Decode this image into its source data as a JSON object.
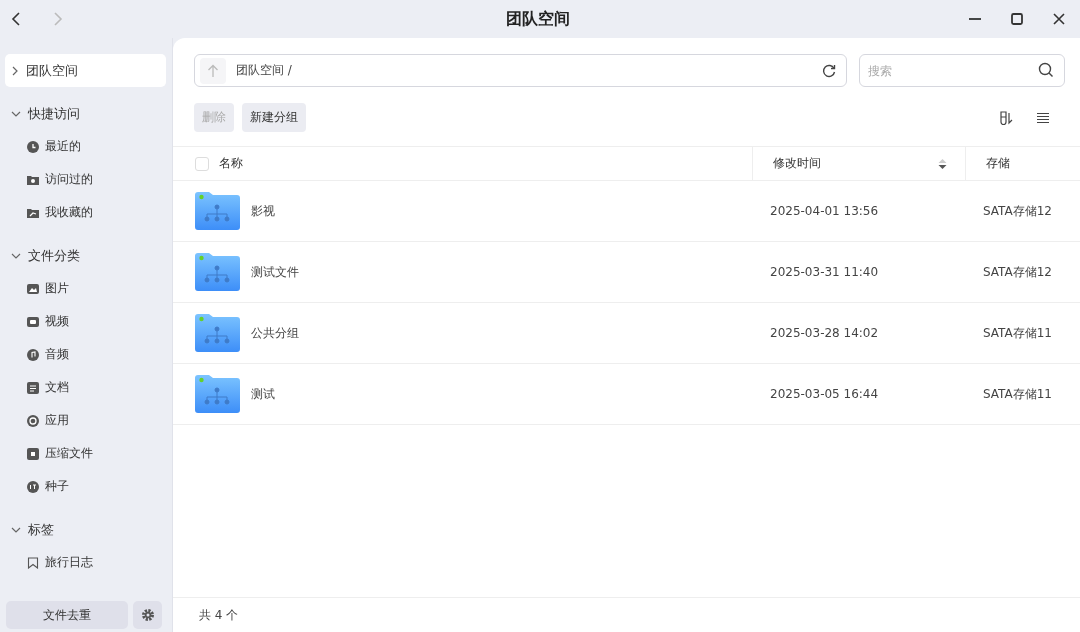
{
  "window": {
    "title": "团队空间"
  },
  "sidebar": {
    "top_item": {
      "label": "团队空间",
      "selected": true,
      "expanded": false
    },
    "groups": [
      {
        "label": "快捷访问",
        "expanded": true,
        "items": [
          {
            "label": "最近的",
            "kind": "clock"
          },
          {
            "label": "访问过的",
            "kind": "visited"
          },
          {
            "label": "我收藏的",
            "kind": "starred"
          }
        ]
      },
      {
        "label": "文件分类",
        "expanded": true,
        "items": [
          {
            "label": "图片",
            "kind": "image"
          },
          {
            "label": "视频",
            "kind": "video"
          },
          {
            "label": "音频",
            "kind": "audio"
          },
          {
            "label": "文档",
            "kind": "document"
          },
          {
            "label": "应用",
            "kind": "app"
          },
          {
            "label": "压缩文件",
            "kind": "archive"
          },
          {
            "label": "种子",
            "kind": "torrent"
          }
        ]
      },
      {
        "label": "标签",
        "expanded": true,
        "items": [
          {
            "label": "旅行日志",
            "kind": "tag"
          }
        ]
      }
    ],
    "bottom_button": "文件去重"
  },
  "path_bar": {
    "path": "团队空间 /"
  },
  "search": {
    "placeholder": "搜索"
  },
  "toolbar": {
    "buttons": [
      {
        "label": "删除",
        "disabled": true
      },
      {
        "label": "新建分组",
        "disabled": false
      }
    ]
  },
  "table": {
    "select_all": {
      "checked": false
    },
    "columns": [
      "名称",
      "修改时间",
      "存储"
    ],
    "rows": [
      {
        "name": "影视",
        "modified": "2025-04-01 13:56",
        "storage": "SATA存储12"
      },
      {
        "name": "测试文件",
        "modified": "2025-03-31 11:40",
        "storage": "SATA存储12"
      },
      {
        "name": "公共分组",
        "modified": "2025-03-28 14:02",
        "storage": "SATA存储11"
      },
      {
        "name": "测试",
        "modified": "2025-03-05 16:44",
        "storage": "SATA存储11"
      }
    ]
  },
  "status_bar": {
    "count": "共 4 个"
  }
}
